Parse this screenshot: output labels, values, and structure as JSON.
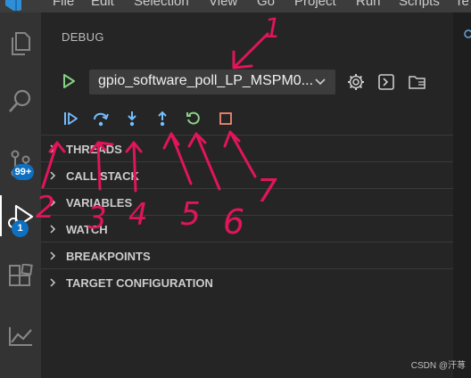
{
  "menubar": {
    "items": [
      "File",
      "Edit",
      "Selection",
      "View",
      "Go",
      "Project",
      "Run",
      "Scripts",
      "Te"
    ]
  },
  "activity_bar": {
    "items": [
      "explorer-icon",
      "search-icon",
      "source-control-icon",
      "run-debug-icon",
      "extensions-icon",
      "analytics-icon"
    ],
    "source_control_badge": "99+",
    "debug_badge": "1"
  },
  "debug_view": {
    "title": "DEBUG",
    "launch_config": "gpio_software_poll_LP_MSPM0...",
    "header_buttons": [
      "gear-icon",
      "terminal-icon",
      "open-folder-icon"
    ],
    "toolbar": [
      {
        "name": "continue",
        "icon": "continue-icon",
        "color": "#75beff"
      },
      {
        "name": "step-over",
        "icon": "step-over-icon",
        "color": "#75beff"
      },
      {
        "name": "step-into",
        "icon": "step-into-icon",
        "color": "#75beff"
      },
      {
        "name": "step-out",
        "icon": "step-out-icon",
        "color": "#75beff"
      },
      {
        "name": "restart",
        "icon": "restart-icon",
        "color": "#89d185"
      },
      {
        "name": "stop",
        "icon": "stop-icon",
        "color": "#f48771"
      }
    ],
    "sections": [
      "THREADS",
      "CALL STACK",
      "VARIABLES",
      "WATCH",
      "BREAKPOINTS",
      "TARGET CONFIGURATION"
    ]
  },
  "annotations": {
    "color": "#e0155a",
    "numbers": [
      "1",
      "2",
      "3",
      "4",
      "5",
      "6",
      "7"
    ]
  },
  "watermark": "CSDN @汗荨"
}
